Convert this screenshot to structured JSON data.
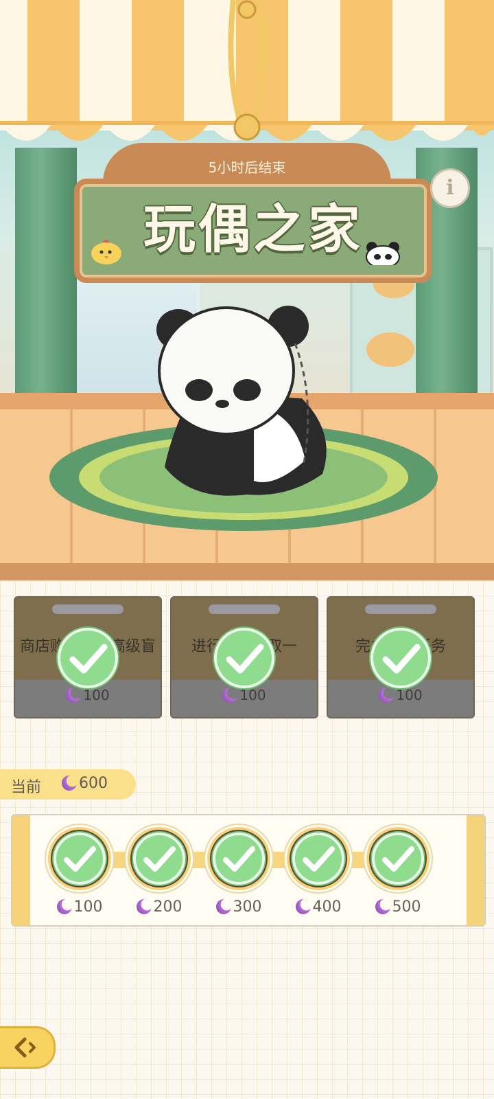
{
  "event": {
    "timer": "5小时后结束",
    "title": "玩偶之家",
    "info_icon": "info-icon"
  },
  "tasks": [
    {
      "text": "商店购买一次高级盲盒兑换券",
      "reward": "100",
      "done": true
    },
    {
      "text": "进行任务领取一",
      "reward": "100",
      "done": true
    },
    {
      "text": "完成一次任务",
      "reward": "100",
      "done": true
    }
  ],
  "current": {
    "label": "当前",
    "value": "600"
  },
  "milestones": [
    {
      "value": "100",
      "done": true
    },
    {
      "value": "200",
      "done": true
    },
    {
      "value": "300",
      "done": true
    },
    {
      "value": "400",
      "done": true
    },
    {
      "value": "500",
      "done": true
    }
  ],
  "colors": {
    "accent": "#f8d35f",
    "check": "#8fdc8f",
    "moon": "#9b55c8"
  }
}
